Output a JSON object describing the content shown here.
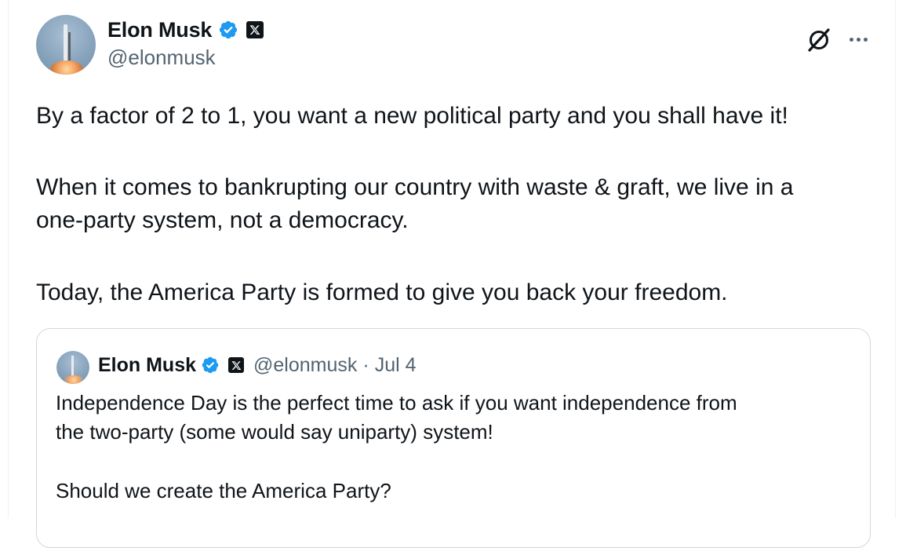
{
  "post": {
    "author": {
      "display_name": "Elon Musk",
      "handle": "@elonmusk",
      "verified_badge": "verified-badge-icon",
      "affiliate_badge": "x-logo-icon",
      "verified_color": "#1d9bf0"
    },
    "actions": {
      "grok_icon": "grok-icon",
      "more_icon": "more-horizontal-icon"
    },
    "text_lines": [
      "By a factor of 2 to 1, you want a new political party and you shall have it!",
      "When it comes to bankrupting our country with waste & graft, we live in a",
      "one-party system, not a democracy.",
      "Today, the America Party is formed to give you back your freedom."
    ]
  },
  "quoted_post": {
    "author": {
      "display_name": "Elon Musk",
      "handle": "@elonmusk",
      "separator": "·",
      "date": "Jul 4"
    },
    "text_lines": [
      "Independence Day is the perfect time to ask if you want independence from",
      "the two-party (some would say uniparty) system!",
      "Should we create the America Party?"
    ]
  }
}
